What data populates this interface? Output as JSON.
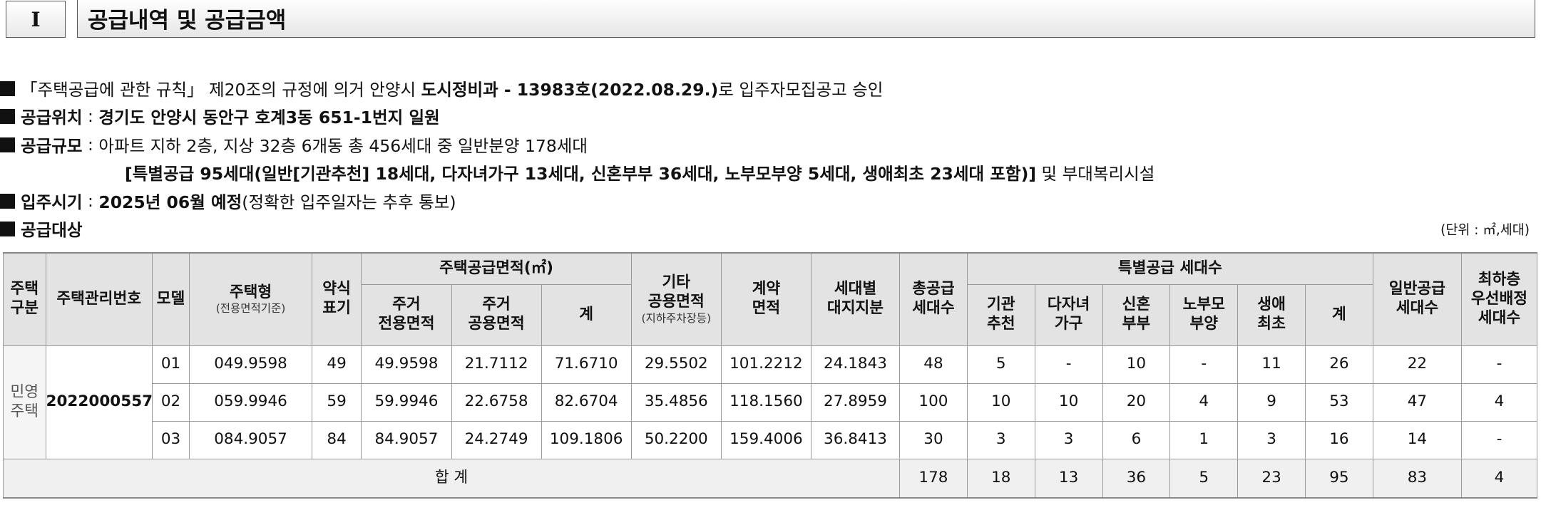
{
  "section": {
    "number": "I",
    "title": "공급내역 및 공급금액"
  },
  "lines": {
    "approval": {
      "pre": "「주택공급에 관한 규칙」 제20조의 규정에 의거 안양시 ",
      "bold": "도시정비과 - 13983호(2022.08.29.)",
      "post": "로 입주자모집공고 승인"
    },
    "location": {
      "label": "공급위치",
      "value": "경기도 안양시 동안구 호계3동 651-1번지 일원"
    },
    "scale": {
      "label": "공급규모",
      "value": "아파트 지하 2층, 지상 32층 6개동 총 456세대 중 일반분양 178세대"
    },
    "scale2": {
      "bold": "[특별공급 95세대(일반[기관추천] 18세대, 다자녀가구 13세대, 신혼부부 36세대, 노부모부양 5세대, 생애최초 23세대 포함)]",
      "post": " 및 부대복리시설"
    },
    "movein": {
      "label": "입주시기",
      "bold": "2025년 06월 예정",
      "post": "(정확한 입주일자는 추후 통보)"
    },
    "target": {
      "label": "공급대상"
    },
    "colon": " : "
  },
  "unit": "(단위 : ㎡,세대)",
  "table": {
    "headers": {
      "type": "주택\n구분",
      "mgmt_no": "주택관리번호",
      "model": "모델",
      "house_type": "주택형",
      "house_type_sub": "(전용면적기준)",
      "abbr": "약식\n표기",
      "area_group": "주택공급면적(㎡)",
      "exclusive": "주거\n전용면적",
      "common": "주거\n공용면적",
      "area_sum": "계",
      "other_common": "기타\n공용면적",
      "other_common_sub": "(지하주차장등)",
      "contract": "계약\n면적",
      "land": "세대별\n대지지분",
      "total": "총공급\n세대수",
      "special_group": "특별공급 세대수",
      "institution": "기관\n추천",
      "multichild": "다자녀\n가구",
      "newlywed": "신혼\n부부",
      "elderly": "노부모\n부양",
      "firsttime": "생애\n최초",
      "special_sum": "계",
      "general": "일반공급\n세대수",
      "lowfloor": "최하층\n우선배정\n세대수"
    },
    "region": "민영\n주택",
    "mgmt_no": "2022000557",
    "rows": [
      {
        "model": "01",
        "house_type": "049.9598",
        "abbr": "49",
        "exclusive": "49.9598",
        "common": "21.7112",
        "area_sum": "71.6710",
        "other_common": "29.5502",
        "contract": "101.2212",
        "land": "24.1843",
        "total": "48",
        "institution": "5",
        "multichild": "-",
        "newlywed": "10",
        "elderly": "-",
        "firsttime": "11",
        "special_sum": "26",
        "general": "22",
        "lowfloor": "-"
      },
      {
        "model": "02",
        "house_type": "059.9946",
        "abbr": "59",
        "exclusive": "59.9946",
        "common": "22.6758",
        "area_sum": "82.6704",
        "other_common": "35.4856",
        "contract": "118.1560",
        "land": "27.8959",
        "total": "100",
        "institution": "10",
        "multichild": "10",
        "newlywed": "20",
        "elderly": "4",
        "firsttime": "9",
        "special_sum": "53",
        "general": "47",
        "lowfloor": "4"
      },
      {
        "model": "03",
        "house_type": "084.9057",
        "abbr": "84",
        "exclusive": "84.9057",
        "common": "24.2749",
        "area_sum": "109.1806",
        "other_common": "50.2200",
        "contract": "159.4006",
        "land": "36.8413",
        "total": "30",
        "institution": "3",
        "multichild": "3",
        "newlywed": "6",
        "elderly": "1",
        "firsttime": "3",
        "special_sum": "16",
        "general": "14",
        "lowfloor": "-"
      }
    ],
    "totals": {
      "label": "합 계",
      "total": "178",
      "institution": "18",
      "multichild": "13",
      "newlywed": "36",
      "elderly": "5",
      "firsttime": "23",
      "special_sum": "95",
      "general": "83",
      "lowfloor": "4"
    }
  }
}
